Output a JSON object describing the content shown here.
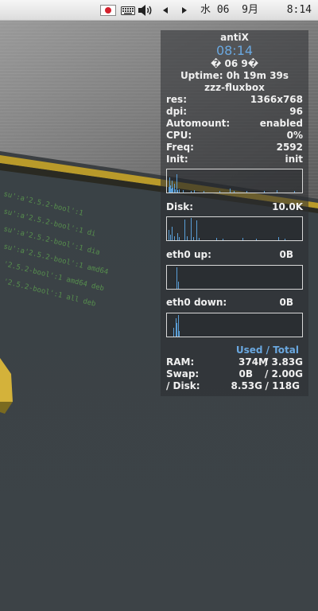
{
  "panel": {
    "date": "水 06  9月",
    "clock": "8:14",
    "icons": {
      "flag": "japan-flag-icon",
      "keyboard": "keyboard-icon",
      "volume": "speaker-volume-icon",
      "prev": "triangle-left-icon",
      "next": "triangle-right-icon"
    }
  },
  "conky": {
    "hostname": "antiX",
    "time": "08:14",
    "date": "� 06  9�",
    "uptime": "Uptime: 0h 19m 39s",
    "session": "zzz-fluxbox",
    "info": [
      {
        "label": "res:",
        "value": "1366x768"
      },
      {
        "label": "dpi:",
        "value": "96"
      },
      {
        "label": "Automount:",
        "value": "enabled"
      },
      {
        "label": "CPU:",
        "value": "0%"
      },
      {
        "label": "Freq:",
        "value": "2592"
      },
      {
        "label": "Init:",
        "value": "init"
      }
    ],
    "disk": {
      "label": "Disk:",
      "value": "10.0K"
    },
    "eth_up": {
      "label": "eth0 up:",
      "value": "0B"
    },
    "eth_down": {
      "label": "eth0 down:",
      "value": "0B"
    },
    "mem_header": {
      "used": "Used",
      "sep": " / ",
      "total": "Total"
    },
    "mem": [
      {
        "label": "RAM:",
        "used": "374M",
        "total": "/ 3.83G"
      },
      {
        "label": "Swap:",
        "used": "0B",
        "total": "/ 2.00G"
      },
      {
        "label": "/ Disk:",
        "used": "8.53G",
        "total": "/ 118G"
      }
    ],
    "graph_color": "#5a9fd8"
  }
}
